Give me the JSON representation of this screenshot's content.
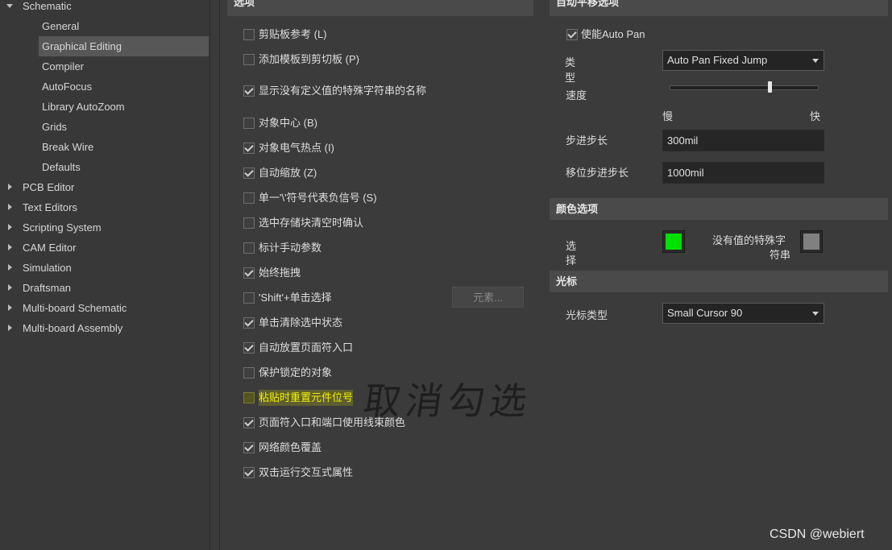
{
  "tree": {
    "schematic": "Schematic",
    "children": [
      "General",
      "Graphical Editing",
      "Compiler",
      "AutoFocus",
      "Library AutoZoom",
      "Grids",
      "Break Wire",
      "Defaults"
    ],
    "selected_child": "Graphical Editing",
    "top_items": [
      "PCB Editor",
      "Text Editors",
      "Scripting System",
      "CAM Editor",
      "Simulation",
      "Draftsman",
      "Multi-board Schematic",
      "Multi-board Assembly"
    ]
  },
  "options": {
    "header": "选项",
    "items": [
      {
        "label": "剪贴板参考 (L)",
        "checked": false
      },
      {
        "label": "添加模板到剪切板 (P)",
        "checked": false
      },
      {
        "label": "显示没有定义值的特殊字符串的名称",
        "checked": true
      },
      {
        "label": "对象中心 (B)",
        "checked": false
      },
      {
        "label": "对象电气热点 (I)",
        "checked": true
      },
      {
        "label": "自动缩放 (Z)",
        "checked": true
      },
      {
        "label": "单一'\\'符号代表负信号 (S)",
        "checked": false
      },
      {
        "label": "选中存储块清空时确认",
        "checked": false
      },
      {
        "label": "标计手动参数",
        "checked": false
      },
      {
        "label": "始终拖拽",
        "checked": true
      },
      {
        "label": "'Shift'+单击选择",
        "checked": false
      },
      {
        "label": "单击清除选中状态",
        "checked": true
      },
      {
        "label": "自动放置页面符入口",
        "checked": true
      },
      {
        "label": "保护锁定的对象",
        "checked": false
      },
      {
        "label": "粘贴时重置元件位号",
        "checked": false,
        "highlighted": true
      },
      {
        "label": "页面符入口和端口使用线束颜色",
        "checked": true
      },
      {
        "label": "网络颜色覆盖",
        "checked": true
      },
      {
        "label": "双击运行交互式属性",
        "checked": true
      }
    ],
    "elements_button": "元素...",
    "annotation": "取消勾选"
  },
  "autopan": {
    "header": "自动平移选项",
    "enable_label": "使能Auto Pan",
    "enable_checked": true,
    "type_label_1": "类",
    "type_label_2": "型",
    "type_value": "Auto Pan Fixed Jump",
    "speed_label": "速度",
    "speed_fraction": 0.68,
    "slow_label": "慢",
    "fast_label": "快",
    "step_label": "步进步长",
    "step_value": "300mil",
    "shift_step_label": "移位步进步长",
    "shift_step_value": "1000mil"
  },
  "colors": {
    "header": "颜色选项",
    "select_label_1": "选",
    "select_label_2": "择",
    "select_color": "#00e000",
    "nostring_label_1": "没有值的特殊字",
    "nostring_label_2": "符串",
    "nostring_color": "#808080"
  },
  "cursor": {
    "header": "光标",
    "type_label": "光标类型",
    "type_value": "Small Cursor 90"
  },
  "watermark": "CSDN @webiert"
}
